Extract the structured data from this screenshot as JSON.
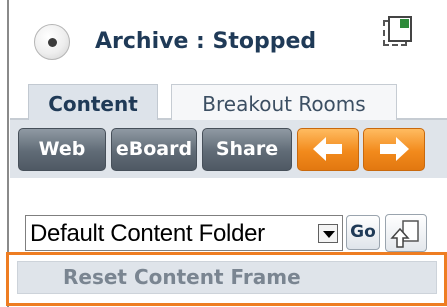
{
  "archive": {
    "status_label": "Archive : Stopped"
  },
  "tabs": [
    {
      "label": "Content",
      "active": true
    },
    {
      "label": "Breakout Rooms",
      "active": false
    }
  ],
  "toolbar": {
    "web_label": "Web",
    "eboard_label": "eBoard",
    "share_label": "Share",
    "prev_icon": "arrow-left-icon",
    "next_icon": "arrow-right-icon"
  },
  "folder": {
    "selected": "Default Content Folder",
    "go_label": "Go",
    "upload_icon": "upload-icon"
  },
  "reset": {
    "label": "Reset Content Frame"
  },
  "colors": {
    "highlight": "#ee7d22",
    "accent_orange": "#f28a1c",
    "button_gray": "#606b76",
    "label_navy": "#1f3a57"
  }
}
